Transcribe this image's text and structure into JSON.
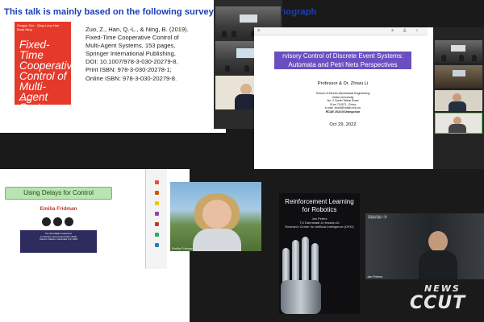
{
  "slide1": {
    "title": "This talk is mainly based on the following survey papers and monograph",
    "book": {
      "authors": "Zongyu Zuo · Qing-Long Han · Boda Ning",
      "title": "Fixed-Time Cooperative Control of Multi-Agent Systems",
      "publisher": "Springer"
    },
    "reference_lines": [
      "Zuo, Z., Han, Q.-L., & Ning, B. (2019).",
      "Fixed-Time Cooperative Control of",
      "Multi-Agent Systems, 153 pages,",
      "Springer International Publishing,",
      "DOI: 10.1007/978-3-030-20279-8,",
      "Print ISBN: 978-3-030-20278-1;",
      "Online ISBN: 978-3-030-20279-8."
    ]
  },
  "slide2": {
    "banner_line1": "rvisory Control of Discrete Event Systems:",
    "banner_line2": "Automata and Petri Nets Perspectives",
    "speaker": "Professor & Dr. Zhiwu Li",
    "affiliation_lines": [
      "School of Electro-Mechanical Engineering",
      "Xidian University",
      "No. 2 South Taibai Road",
      "Xi'an 710071, China",
      "e-mail: zhwli@xidian.edu.cn",
      "RCAE 2022@Changchun"
    ],
    "date": "Oct 29, 2022"
  },
  "slide3": {
    "banner": "Using Delays for Control",
    "speaker": "Emilia Fridman",
    "conf_lines": [
      "The 61st IEEE Conference",
      "on Decision and Control (CDC 2022)",
      "Cancún, Mexico, December 6-9, 2022"
    ],
    "video_caption": "Emilia Fridman"
  },
  "slide4": {
    "title_line1": "Reinforcement Learning",
    "title_line2": "for Robotics",
    "author": "Jan Peters",
    "affil_lines": [
      "TU Darmstadt & Hessian.AI",
      "Research Center for Artificial Intelligence (DFKI)"
    ]
  },
  "video5": {
    "caption": "Jan Peters",
    "header": "高级机器人学"
  },
  "watermark": {
    "top": "NEWS",
    "bottom": "CCUT"
  },
  "colors": {
    "slide1_title": "#1a3db6",
    "book_cover": "#e53a2b",
    "slide2_banner": "#6b4fc0",
    "slide3_banner": "#b9e3b0",
    "slide3_name": "#c0392b"
  }
}
